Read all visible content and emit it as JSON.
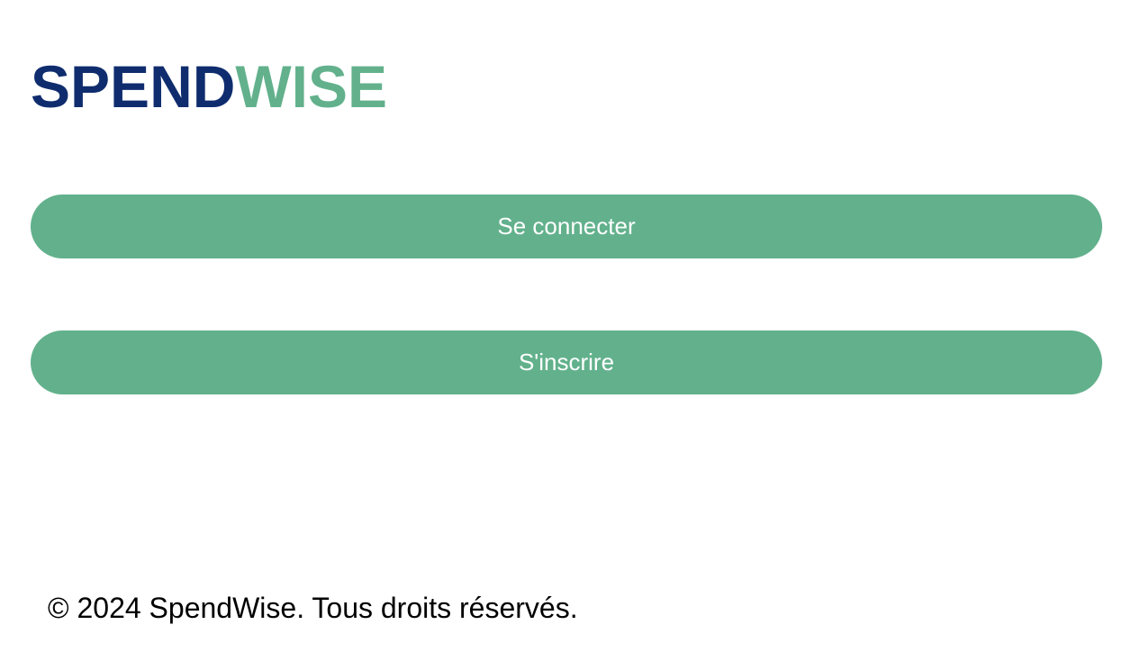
{
  "brand": {
    "part1": "SPEND",
    "part2": "WISE",
    "color_primary": "#0f2d6e",
    "color_accent": "#62b18c"
  },
  "actions": {
    "login_label": "Se connecter",
    "signup_label": "S'inscrire",
    "button_color": "#62b18c",
    "button_text_color": "#ffffff"
  },
  "footer": {
    "copyright": "© 2024 SpendWise. Tous droits réservés."
  }
}
